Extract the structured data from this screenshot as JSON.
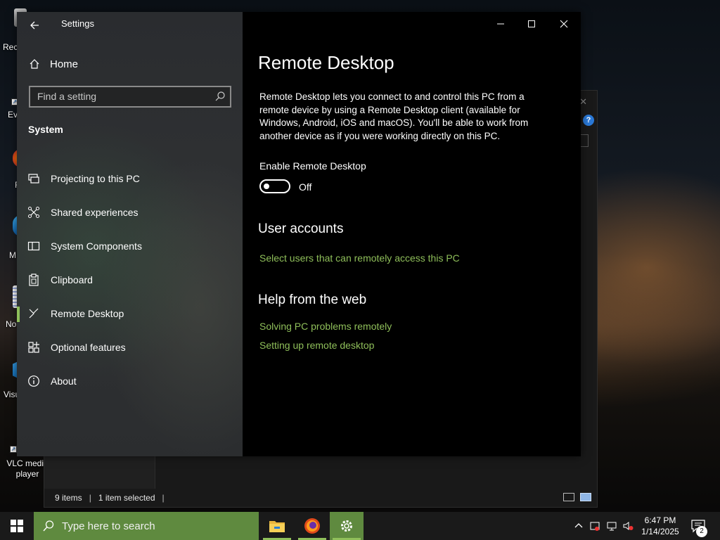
{
  "desktop": {
    "icons": [
      {
        "label": "Rec",
        "icon": "recycle-bin-icon"
      },
      {
        "label": "Eve",
        "icon": "app-icon"
      },
      {
        "label": "F",
        "icon": "firefox-icon"
      },
      {
        "label": "M",
        "icon": "edge-icon"
      },
      {
        "label": "No",
        "icon": "notepad-icon"
      },
      {
        "label": "Visu",
        "icon": "vscode-icon"
      },
      {
        "label": "VLC media player",
        "icon": "vlc-icon"
      }
    ]
  },
  "explorer": {
    "status_items": "9 items",
    "status_selected": "1 item selected",
    "help_badge": "?"
  },
  "settings": {
    "title": "Settings",
    "home_label": "Home",
    "search_placeholder": "Find a setting",
    "section_label": "System",
    "nav_items": [
      {
        "label": "Projecting to this PC",
        "icon": "projector-icon",
        "selected": false
      },
      {
        "label": "Shared experiences",
        "icon": "shared-experiences-icon",
        "selected": false
      },
      {
        "label": "System Components",
        "icon": "system-components-icon",
        "selected": false
      },
      {
        "label": "Clipboard",
        "icon": "clipboard-icon",
        "selected": false
      },
      {
        "label": "Remote Desktop",
        "icon": "remote-desktop-icon",
        "selected": true
      },
      {
        "label": "Optional features",
        "icon": "optional-features-icon",
        "selected": false
      },
      {
        "label": "About",
        "icon": "info-icon",
        "selected": false
      }
    ],
    "content": {
      "title": "Remote Desktop",
      "description": "Remote Desktop lets you connect to and control this PC from a remote device by using a Remote Desktop client (available for Windows, Android, iOS and macOS). You'll be able to work from another device as if you were working directly on this PC.",
      "enable_label": "Enable Remote Desktop",
      "toggle_state": "Off",
      "toggle_on": false,
      "user_accounts_heading": "User accounts",
      "user_accounts_link": "Select users that can remotely access this PC",
      "help_heading": "Help from the web",
      "help_links": [
        "Solving PC problems remotely",
        "Setting up remote desktop"
      ]
    }
  },
  "taskbar": {
    "search_placeholder": "Type here to search",
    "apps": [
      "file-explorer-icon",
      "firefox-icon",
      "settings-gear-icon"
    ],
    "time": "6:47 PM",
    "date": "1/14/2025",
    "notification_count": "2"
  },
  "colors": {
    "accent": "#8fbf5a",
    "taskbar_accent": "#5f8a3f",
    "content_bg": "#000000"
  }
}
